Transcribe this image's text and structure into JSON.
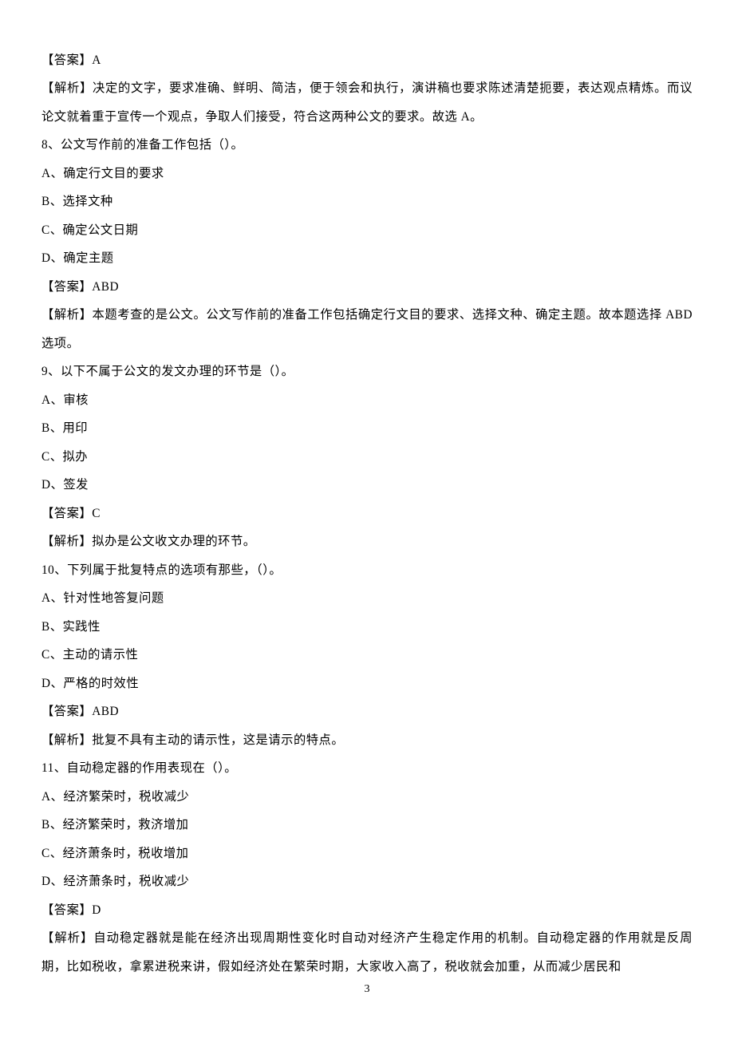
{
  "lines": {
    "l0": "【答案】A",
    "l1": "【解析】决定的文字，要求准确、鲜明、简洁，便于领会和执行，演讲稿也要求陈述清楚扼要，表达观点精炼。而议论文就着重于宣传一个观点，争取人们接受，符合这两种公文的要求。故选 A。",
    "l2": "8、公文写作前的准备工作包括（）。",
    "l3": "A、确定行文目的要求",
    "l4": "B、选择文种",
    "l5": "C、确定公文日期",
    "l6": "D、确定主题",
    "l7": "【答案】ABD",
    "l8": "【解析】本题考查的是公文。公文写作前的准备工作包括确定行文目的要求、选择文种、确定主题。故本题选择 ABD 选项。",
    "l9": "9、以下不属于公文的发文办理的环节是（）。",
    "l10": "A、审核",
    "l11": "B、用印",
    "l12": "C、拟办",
    "l13": "D、签发",
    "l14": "【答案】C",
    "l15": "【解析】拟办是公文收文办理的环节。",
    "l16": "10、下列属于批复特点的选项有那些，（）。",
    "l17": "A、针对性地答复问题",
    "l18": "B、实践性",
    "l19": "C、主动的请示性",
    "l20": "D、严格的时效性",
    "l21": "【答案】ABD",
    "l22": "【解析】批复不具有主动的请示性，这是请示的特点。",
    "l23": "11、自动稳定器的作用表现在（）。",
    "l24": "A、经济繁荣时，税收减少",
    "l25": "B、经济繁荣时，救济增加",
    "l26": "C、经济萧条时，税收增加",
    "l27": "D、经济萧条时，税收减少",
    "l28": "【答案】D",
    "l29": "【解析】自动稳定器就是能在经济出现周期性变化时自动对经济产生稳定作用的机制。自动稳定器的作用就是反周期，比如税收，拿累进税来讲，假如经济处在繁荣时期，大家收入高了，税收就会加重，从而减少居民和"
  },
  "pageNumber": "3"
}
